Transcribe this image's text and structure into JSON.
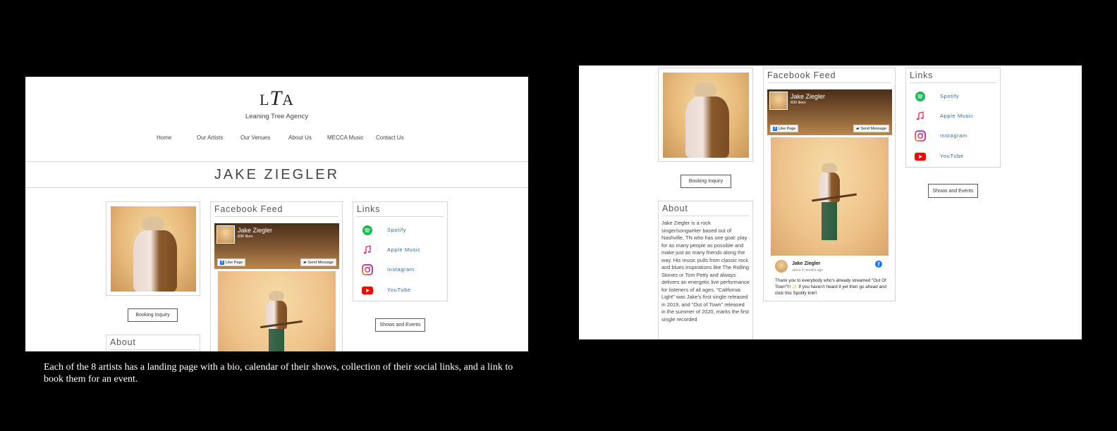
{
  "site": {
    "logo": {
      "l": "L",
      "t": "T",
      "a": "A"
    },
    "agency_name": "Leaning Tree Agency",
    "nav": [
      "Home",
      "Our Artists",
      "Our Venues",
      "About Us",
      "MECCA Music",
      "Contact Us"
    ],
    "artist_name": "JAKE ZIEGLER"
  },
  "booking_label": "Booking Inquiry",
  "shows_label": "Shows and Events",
  "facebook": {
    "title": "Facebook Feed",
    "page_name": "Jake Ziegler",
    "likes": "836 likes",
    "like_button": "Like Page",
    "message_button": "Send Message",
    "post": {
      "author": "Jake Ziegler",
      "time": "about 4 months ago",
      "text": "Thank you to everybody who's already streamed \"Out Of Town\"!!! ✨ If you haven't heard it yet then go ahead and click this Spotify link!!"
    }
  },
  "links": {
    "title": "Links",
    "items": [
      {
        "label": "Spotify",
        "icon": "spotify-icon",
        "color": "#1db954"
      },
      {
        "label": "Apple Music",
        "icon": "apple-music-icon",
        "color": "#fa2d55"
      },
      {
        "label": "Instagram",
        "icon": "instagram-icon",
        "color": "#c13584"
      },
      {
        "label": "YouTube",
        "icon": "youtube-icon",
        "color": "#ff0000"
      }
    ]
  },
  "about": {
    "title": "About",
    "text": "Jake Ziegler is a rock singer/songwriter based out of Nashville, TN who has one goal: play for as many people as possible and make just as many friends along the way.  His music pulls from classic rock and blues inspirations like The Rolling Stones or Tom Petty and always delivers an energetic live performance for listeners of all ages.  \"California Light\" was Jake's first single released in 2019, and \"Out of Town\" released in the summer of 2020, marks the first single recorded"
  },
  "caption": "Each of the 8 artists has a landing page with a bio, calendar of their shows, collection of their social links, and a link to book them for an event."
}
